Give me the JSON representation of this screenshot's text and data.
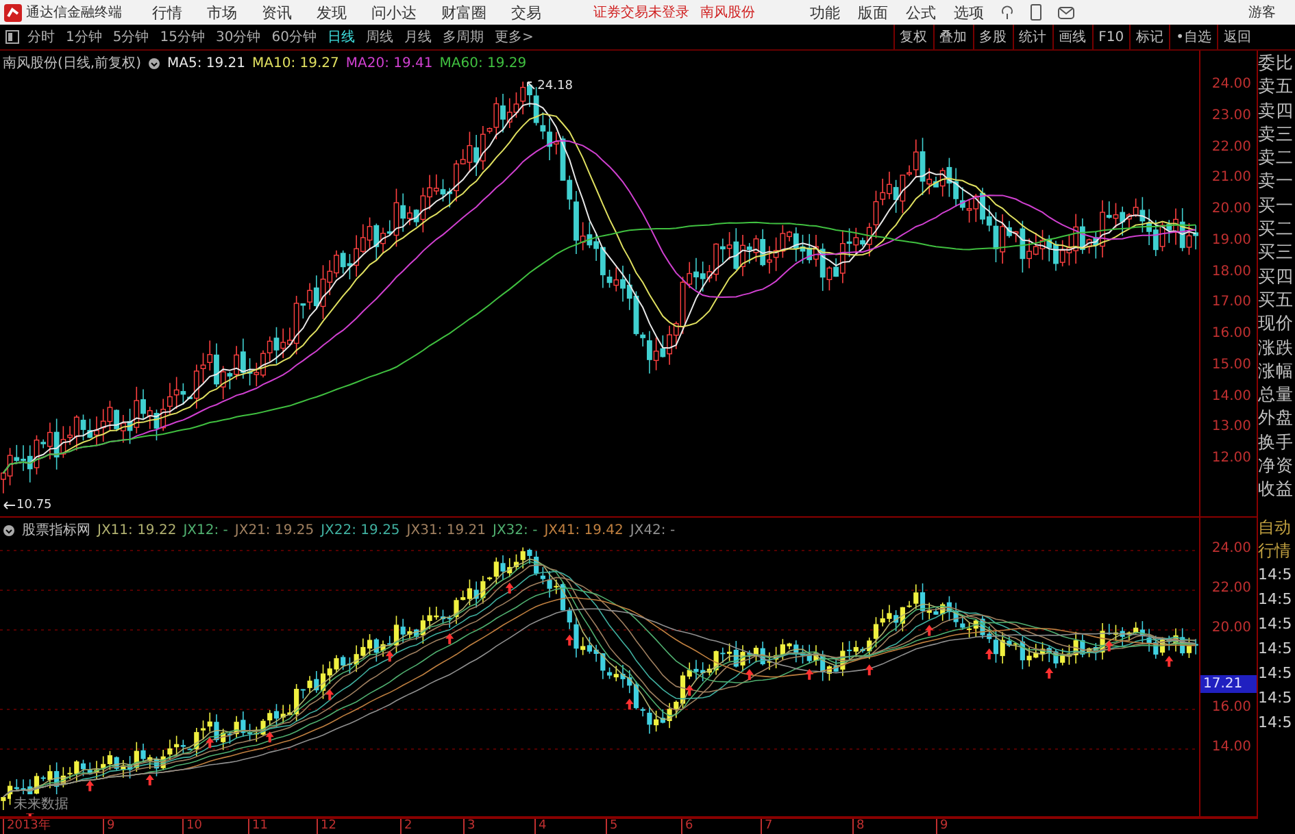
{
  "menubar": {
    "app_title": "通达信金融终端",
    "menus": [
      "行情",
      "市场",
      "资讯",
      "发现",
      "问小达",
      "财富圈",
      "交易"
    ],
    "status": "证券交易未登录",
    "stock": "南风股份",
    "right_menus": [
      "功能",
      "版面",
      "公式",
      "选项"
    ],
    "user": "游客"
  },
  "period_bar": {
    "periods": [
      {
        "label": "分时",
        "selected": false
      },
      {
        "label": "1分钟",
        "selected": false
      },
      {
        "label": "5分钟",
        "selected": false
      },
      {
        "label": "15分钟",
        "selected": false
      },
      {
        "label": "30分钟",
        "selected": false
      },
      {
        "label": "60分钟",
        "selected": false
      },
      {
        "label": "日线",
        "selected": true
      },
      {
        "label": "周线",
        "selected": false
      },
      {
        "label": "月线",
        "selected": false
      },
      {
        "label": "多周期",
        "selected": false
      },
      {
        "label": "更多>",
        "selected": false
      }
    ],
    "tools": [
      "复权",
      "叠加",
      "多股",
      "统计",
      "画线",
      "F10",
      "标记",
      "•自选",
      "返回"
    ]
  },
  "main_chart": {
    "title": "南风股份(日线,前复权)",
    "ma": [
      {
        "label": "MA5: 19.21",
        "color": "#e8e8e8"
      },
      {
        "label": "MA10: 19.27",
        "color": "#e0e060"
      },
      {
        "label": "MA20: 19.41",
        "color": "#d040d0"
      },
      {
        "label": "MA60: 19.29",
        "color": "#40c040"
      }
    ],
    "yaxis": [
      "24.00",
      "23.00",
      "22.00",
      "21.00",
      "20.00",
      "19.00",
      "18.00",
      "17.00",
      "16.00",
      "15.00",
      "14.00",
      "13.00",
      "12.00"
    ],
    "high_label": "24.18",
    "low_label": "10.75"
  },
  "indicator_chart": {
    "title": "股票指标网",
    "lines": [
      {
        "label": "JX11: 19.22",
        "color": "#b0b070"
      },
      {
        "label": "JX12: -",
        "color": "#50b070"
      },
      {
        "label": "JX21: 19.25",
        "color": "#a08060"
      },
      {
        "label": "JX22: 19.25",
        "color": "#40b0a0"
      },
      {
        "label": "JX31: 19.21",
        "color": "#a08060"
      },
      {
        "label": "JX32: -",
        "color": "#50b070"
      },
      {
        "label": "JX41: 19.42",
        "color": "#c08040"
      },
      {
        "label": "JX42: -",
        "color": "#909090"
      }
    ],
    "yaxis": [
      "24.00",
      "22.00",
      "20.00",
      "16.00",
      "14.00"
    ],
    "current_price": "17.21",
    "note": "未来数据"
  },
  "time_axis": [
    "2013年",
    "9",
    "10",
    "11",
    "12",
    "2",
    "3",
    "4",
    "5",
    "6",
    "7",
    "8",
    "9"
  ],
  "quote_panel": {
    "labels": [
      "委比",
      "卖五",
      "卖四",
      "卖三",
      "卖二",
      "卖一",
      "买一",
      "买二",
      "买三",
      "买四",
      "买五",
      "现价",
      "涨跌",
      "涨幅",
      "总量",
      "外盘",
      "换手",
      "净资",
      "收益"
    ],
    "tabs": [
      "自动",
      "行情"
    ],
    "times": [
      "14:5",
      "14:5",
      "14:5",
      "14:5",
      "14:5",
      "14:5",
      "14:5"
    ]
  }
}
